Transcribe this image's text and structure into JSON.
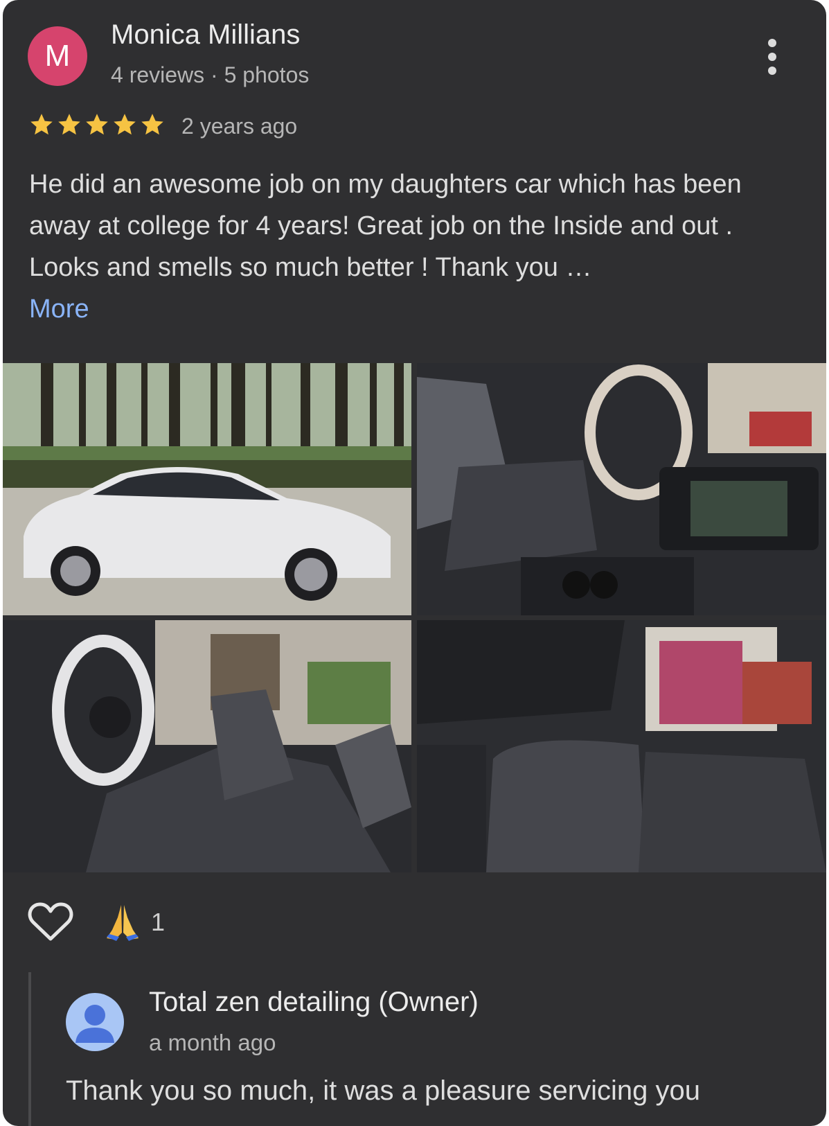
{
  "review": {
    "avatar_letter": "M",
    "author": "Monica Millians",
    "author_meta": "4 reviews · 5 photos",
    "rating": 5,
    "time": "2 years ago",
    "text": "He did an awesome job on my daughters car which has been away at college for 4 years! Great job on the Inside and out . Looks and smells so much better ! Thank you …",
    "more_label": "More"
  },
  "photos": [
    {
      "subject": "white sedan parked in driveway"
    },
    {
      "subject": "car interior front seats and dashboard"
    },
    {
      "subject": "steering wheel with cover and driver seat"
    },
    {
      "subject": "rear seats interior"
    }
  ],
  "reactions": {
    "like_icon": "heart-outline-icon",
    "emoji": "🙏",
    "count": "1"
  },
  "owner_reply": {
    "author": "Total zen detailing (Owner)",
    "time": "a month ago",
    "text": "Thank you so much, it was a pleasure servicing you"
  },
  "colors": {
    "card_bg": "#2f2f31",
    "avatar": "#d6446d",
    "star": "#f6c343",
    "link": "#8ab4f8",
    "owner_avatar": "#a9c6f5"
  }
}
